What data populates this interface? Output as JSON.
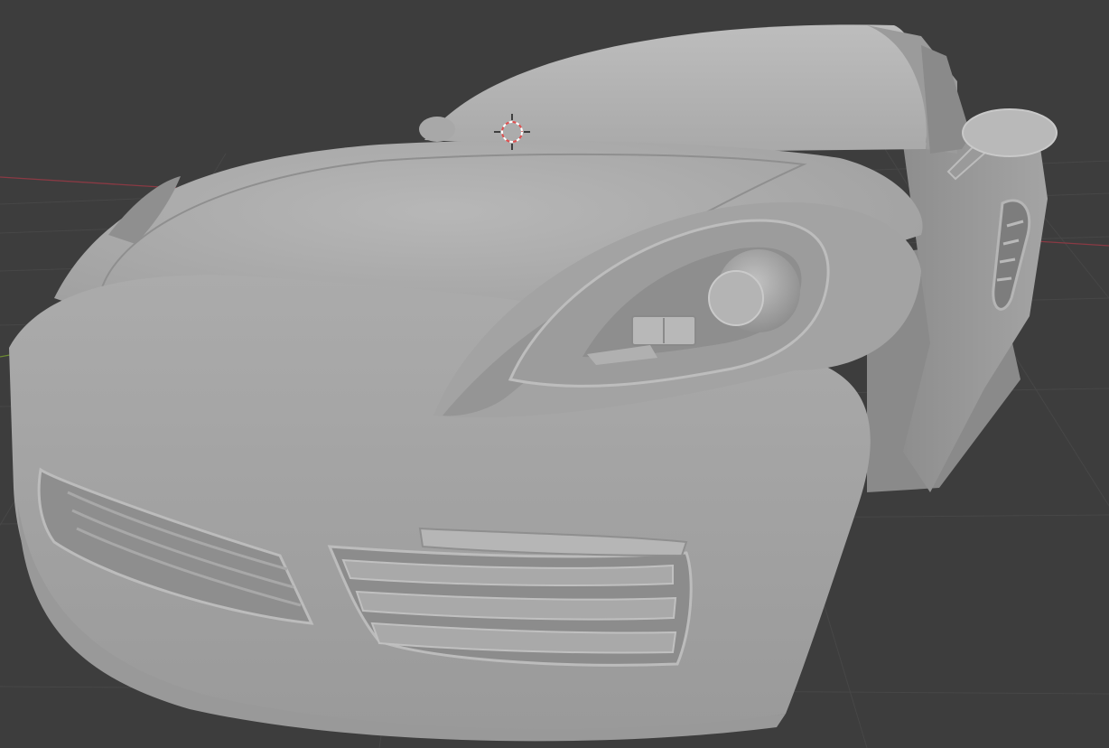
{
  "app": "3D viewport",
  "viewport": {
    "background_color": "#3d3d3d",
    "grid_color": "#474747",
    "x_axis_color": "#8a3a44",
    "y_axis_color": "#6b8a32"
  },
  "scene": {
    "object": "sports-car-clay-model",
    "shading": "solid",
    "model_color": "#a9a9a9"
  },
  "cursor_3d": {
    "icon": "3d-cursor-icon",
    "ring_colors": [
      "#e05050",
      "#ffffff"
    ]
  }
}
